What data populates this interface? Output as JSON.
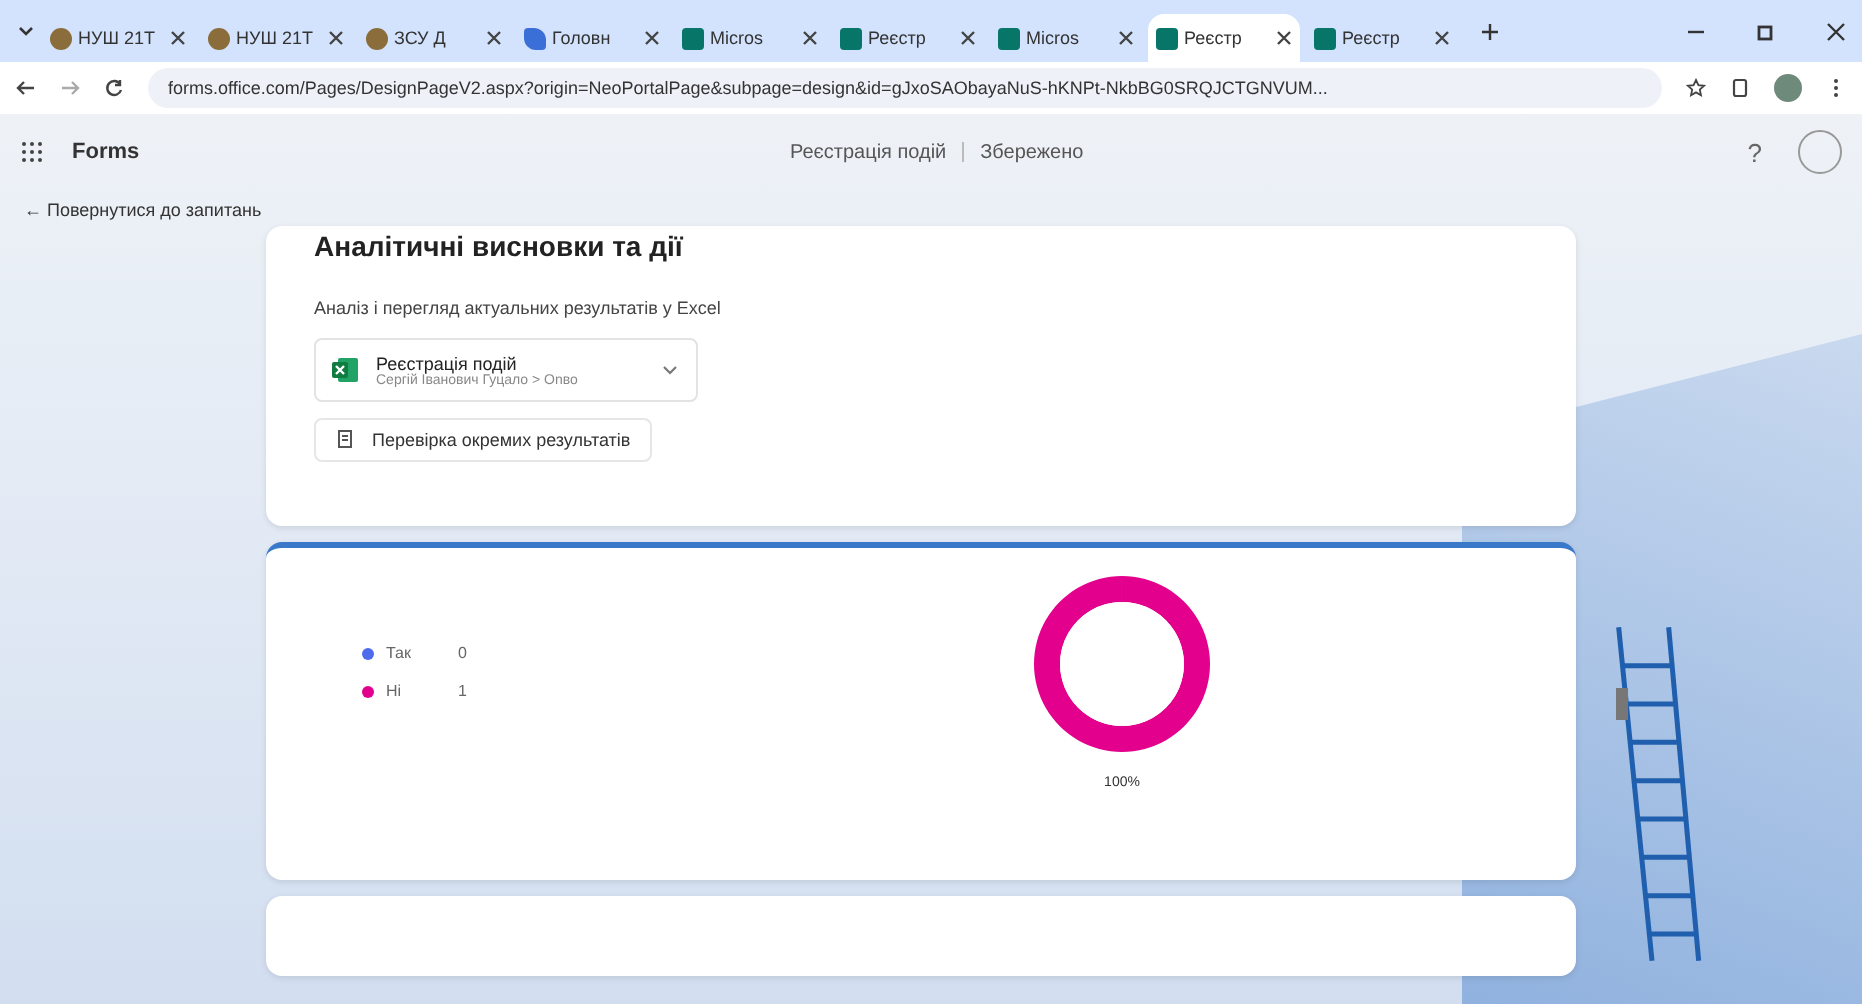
{
  "browser": {
    "tabs": [
      {
        "label": "НУШ 21Т",
        "selected": false,
        "kind": "globe"
      },
      {
        "label": "НУШ 21Т",
        "selected": false,
        "kind": "globe"
      },
      {
        "label": "ЗСУ Д",
        "selected": false,
        "kind": "globe"
      },
      {
        "label": "Головн",
        "selected": false,
        "kind": "drive"
      },
      {
        "label": "Micros",
        "selected": false,
        "kind": "forms"
      },
      {
        "label": "Реєстр",
        "selected": false,
        "kind": "forms"
      },
      {
        "label": "Micros",
        "selected": false,
        "kind": "forms"
      },
      {
        "label": "Реєстр",
        "selected": true,
        "kind": "forms"
      },
      {
        "label": "Реєстр",
        "selected": false,
        "kind": "forms"
      }
    ],
    "url": "forms.office.com/Pages/DesignPageV2.aspx?origin=NeoPortalPage&subpage=design&id=gJxoSAObayaNuS-hKNPt-NkbBG0SRQJCTGNVUM..."
  },
  "app": {
    "name": "Forms",
    "form_title": "Реєстрація подій",
    "save_status": "Збережено",
    "help": "?"
  },
  "back_link": "← Повернутися до запитань",
  "insights": {
    "title": "Аналітичні висновки та дії",
    "subtitle": "Аналіз і перегляд актуальних результатів у Excel",
    "file": {
      "name": "Реєстрація подій",
      "path": "Сергій Іванович Гуцало > Onво"
    },
    "review_button": "Перевірка окремих результатів"
  },
  "question_card": {
    "legend": [
      {
        "count": "0",
        "color": "#4f6bed"
      },
      {
        "count": "1",
        "color": "#e3008c"
      }
    ],
    "chart_data": {
      "type": "donut",
      "categories": [
        "Так",
        "Ні"
      ],
      "series": [
        {
          "values": [
            0,
            1
          ]
        }
      ],
      "value_labels": [
        null,
        "100%"
      ]
    }
  }
}
